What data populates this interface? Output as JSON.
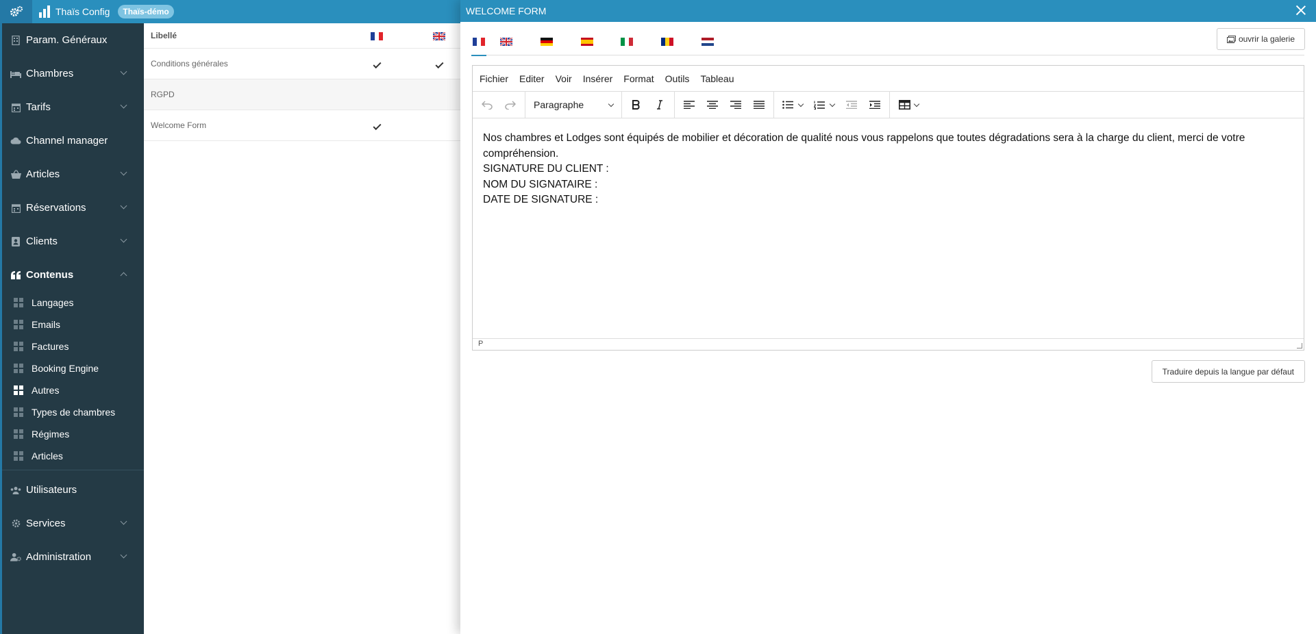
{
  "topbar": {
    "brand": "Thaïs Config",
    "badge": "Thaïs-démo"
  },
  "sidebar": {
    "items": [
      {
        "label": "Param. Généraux",
        "icon": "building-icon"
      },
      {
        "label": "Chambres",
        "icon": "bed-icon"
      },
      {
        "label": "Tarifs",
        "icon": "calendar-icon"
      },
      {
        "label": "Channel manager",
        "icon": "cloud-icon"
      },
      {
        "label": "Articles",
        "icon": "basket-icon"
      },
      {
        "label": "Réservations",
        "icon": "calendar-icon"
      },
      {
        "label": "Clients",
        "icon": "contact-icon"
      },
      {
        "label": "Contenus",
        "icon": "quote-icon"
      },
      {
        "label": "Utilisateurs",
        "icon": "users-icon"
      },
      {
        "label": "Services",
        "icon": "gear-icon"
      },
      {
        "label": "Administration",
        "icon": "user-cog-icon"
      }
    ],
    "sub_items": [
      "Langages",
      "Emails",
      "Factures",
      "Booking Engine",
      "Autres",
      "Types de chambres",
      "Régimes",
      "Articles"
    ],
    "active_sub": "Autres"
  },
  "table": {
    "header": "Libellé",
    "rows": [
      {
        "label": "Conditions générales",
        "fr": true,
        "en": true
      },
      {
        "label": "RGPD",
        "fr": false,
        "en": false
      },
      {
        "label": "Welcome Form",
        "fr": true,
        "en": false
      }
    ]
  },
  "drawer": {
    "title": "WELCOME FORM",
    "gallery_label": "ouvrir la galerie",
    "languages": [
      "fr",
      "en",
      "de",
      "es",
      "it",
      "ro",
      "nl"
    ],
    "active_language": "fr",
    "editor": {
      "menu": [
        "Fichier",
        "Editer",
        "Voir",
        "Insérer",
        "Format",
        "Outils",
        "Tableau"
      ],
      "block_format": "Paragraphe",
      "content": [
        "Nos chambres et Lodges sont équipés de mobilier et décoration de qualité nous vous rappelons que toutes dégradations sera à la charge du client, merci de votre compréhension.",
        "SIGNATURE DU CLIENT :",
        "NOM DU SIGNATAIRE :",
        "DATE DE SIGNATURE :"
      ],
      "status_path": "P"
    },
    "translate_label": "Traduire depuis la langue par défaut"
  },
  "colors": {
    "primary": "#2a8fbd",
    "sidebar_bg": "#243a45",
    "badge_bg": "#7fc4e2"
  }
}
